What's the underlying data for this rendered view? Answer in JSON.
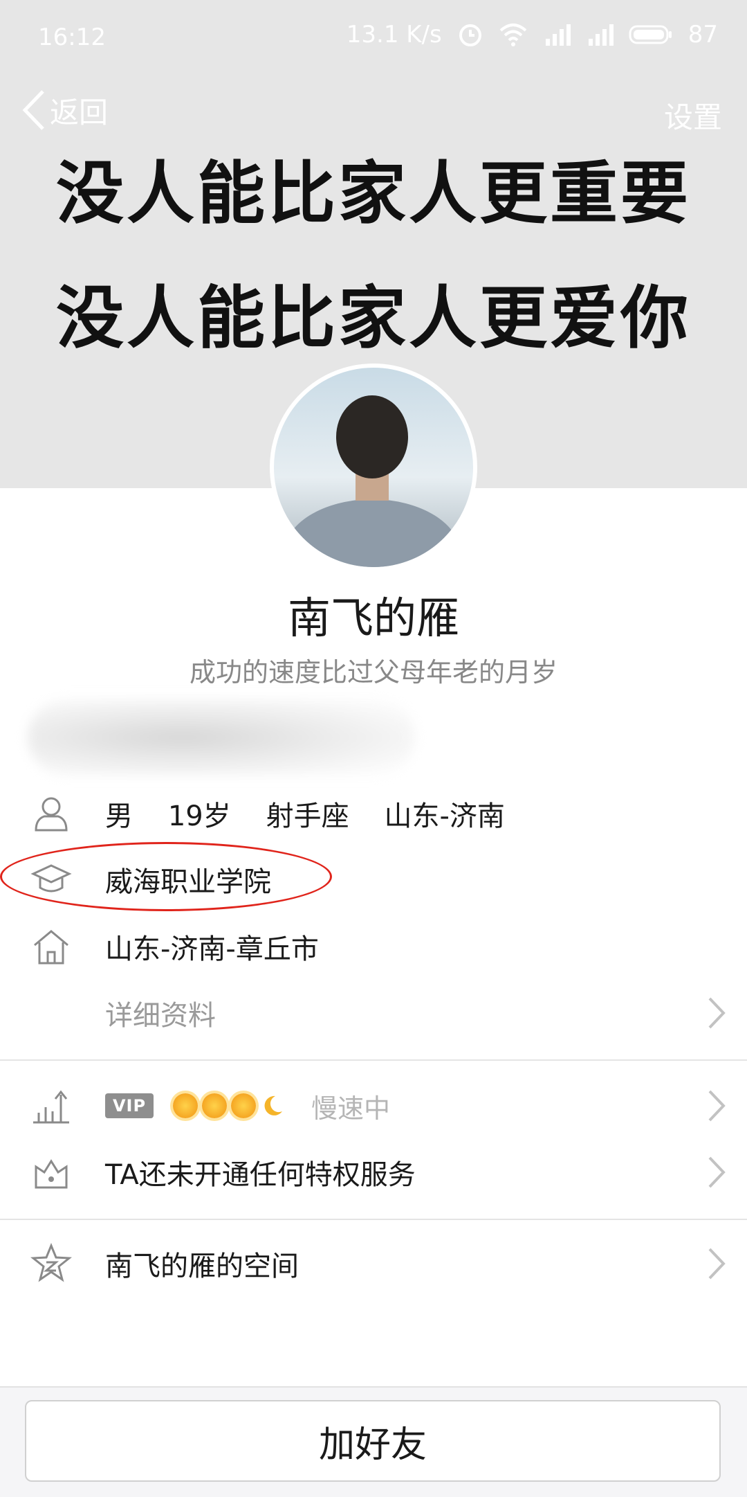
{
  "status_bar": {
    "time": "16:12",
    "net_speed": "13.1 K/s",
    "battery": "87"
  },
  "nav": {
    "back_label": "返回",
    "settings_label": "设置"
  },
  "cover": {
    "line1": "没人能比家人更重要",
    "line2": "没人能比家人更爱你"
  },
  "profile": {
    "nickname": "南飞的雁",
    "signature": "成功的速度比过父母年老的月岁"
  },
  "info": {
    "basic": "男    19岁    射手座    山东-济南",
    "school": "威海职业学院",
    "hometown": "山东-济南-章丘市",
    "detail_link": "详细资料"
  },
  "vip": {
    "badge": "VIP",
    "status": "慢速中",
    "privilege_text": "TA还未开通任何特权服务"
  },
  "space": {
    "label": "南飞的雁的空间"
  },
  "actions": {
    "add_friend": "加好友"
  },
  "colors": {
    "highlight_oval": "#e0241b",
    "cover_bg": "#e6e6e6"
  }
}
